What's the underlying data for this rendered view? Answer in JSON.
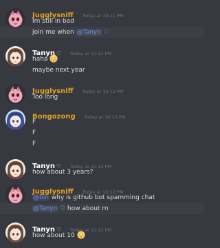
{
  "colors": {
    "background": "#36393f",
    "jugglysniff": "#e0a021",
    "bongozong": "#e0a021",
    "tanyn": "#ffffff",
    "mention": "#7289da",
    "timestamp": "#72767d"
  },
  "messages": [
    {
      "username": "Jugglysniff",
      "heart": "",
      "timestamp": "Today at 10:11 PM",
      "lines": [
        {
          "text": "Im still in bed"
        },
        {
          "text": "Join me when ",
          "mention": "@Tanyn",
          "suffix": " ♡"
        }
      ]
    },
    {
      "username": "Tanyn",
      "heart": "♡",
      "timestamp": "Today at 10:11 PM",
      "lines": [
        {
          "text": "haha",
          "emoji": "flushed-face"
        },
        {
          "text": "maybe next year"
        }
      ]
    },
    {
      "username": "Jugglysniff",
      "heart": "",
      "timestamp": "Today at 10:12 PM",
      "lines": [
        {
          "text": "Too long"
        }
      ]
    },
    {
      "username": "Bongozong",
      "heart": "",
      "timestamp": "Today at 10:12 PM",
      "lines": [
        {
          "text": "F"
        },
        {
          "text": "F"
        },
        {
          "text": "F"
        }
      ]
    },
    {
      "username": "Tanyn",
      "heart": "♡",
      "timestamp": "Today at 10:12 PM",
      "lines": [
        {
          "text": "how about 3 years?"
        }
      ]
    },
    {
      "username": "Jugglysniff",
      "heart": "",
      "timestamp": "Today at 10:12 PM",
      "lines": [
        {
          "mention": "@bin",
          "text": " why is github bot spamming chat"
        },
        {
          "mention": "@Tanyn",
          "suffix": " ♡ how about rn"
        }
      ]
    },
    {
      "username": "Tanyn",
      "heart": "♡",
      "timestamp": "Today at 10:12 PM",
      "lines": [
        {
          "text": "how about 10",
          "emoji": "flushed-face"
        }
      ]
    }
  ]
}
